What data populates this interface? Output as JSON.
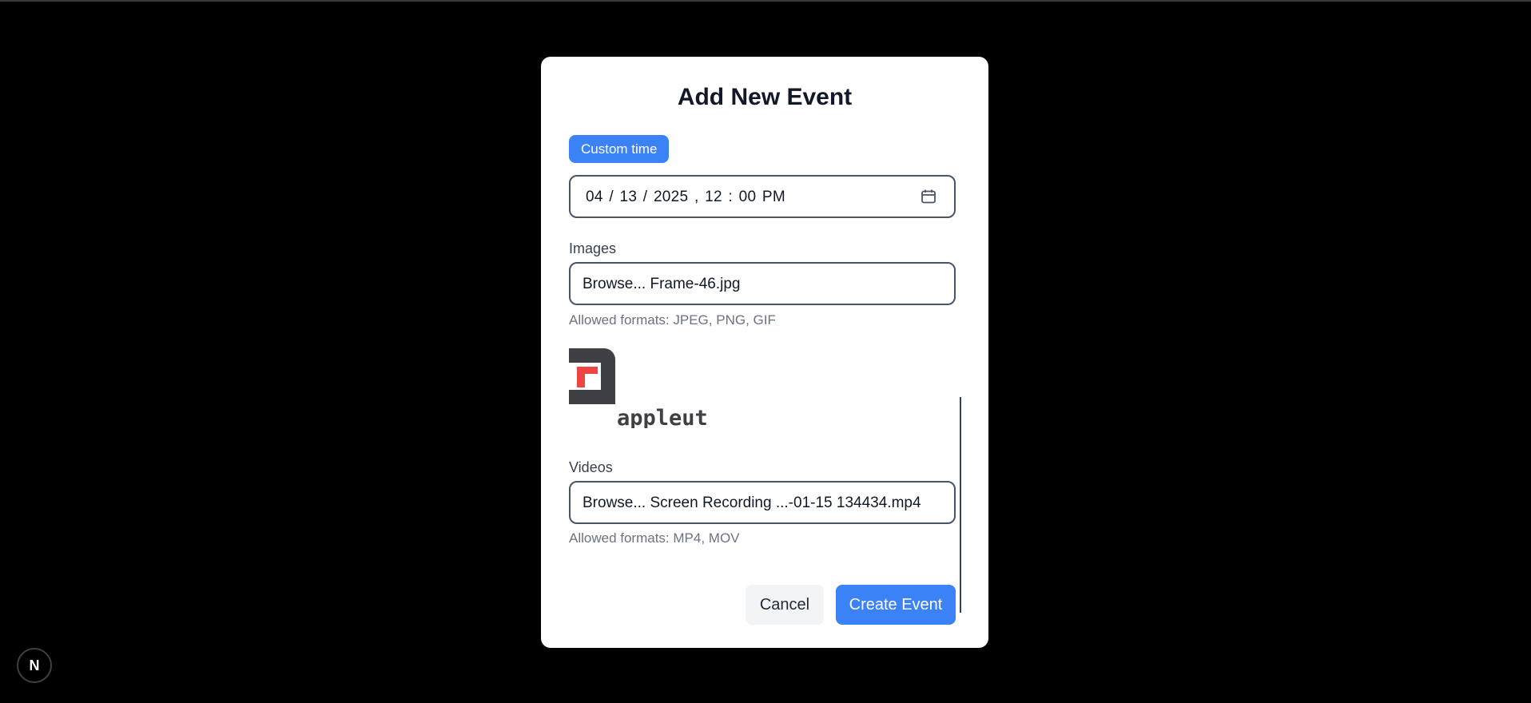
{
  "modal": {
    "title": "Add New Event",
    "custom_time_label": "Custom time",
    "datetime_value": "04 / 13 / 2025 ,  12 : 00   PM",
    "images": {
      "label": "Images",
      "browse_label": "Browse...",
      "file_name": "Frame-46.jpg",
      "hint": "Allowed formats: JPEG, PNG, GIF",
      "preview_text": "appleut"
    },
    "videos": {
      "label": "Videos",
      "browse_label": "Browse...",
      "file_name": "Screen Recording ...-01-15 134434.mp4",
      "hint": "Allowed formats: MP4, MOV"
    },
    "cancel_label": "Cancel",
    "create_label": "Create Event"
  },
  "dev_badge": {
    "label": "N"
  },
  "colors": {
    "accent": "#3b82f6",
    "overlay": "#000000",
    "logo_red": "#ef4444",
    "logo_dark": "#3f3f46"
  },
  "icons": {
    "datetime": "calendar-icon"
  }
}
